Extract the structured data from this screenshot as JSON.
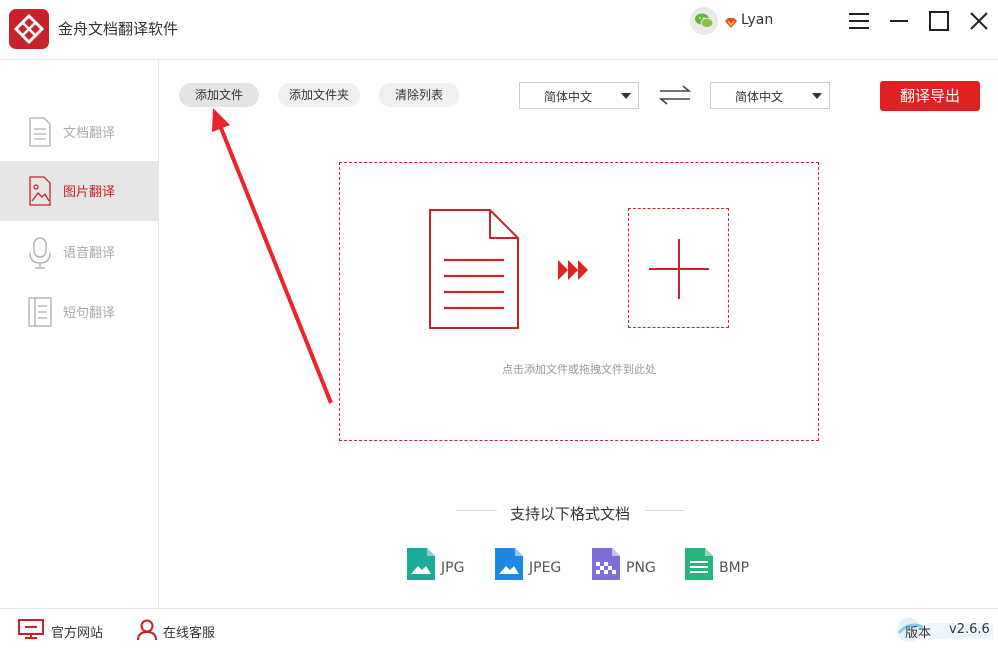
{
  "app": {
    "title": "金舟文档翻译软件",
    "accent": "#c8232c",
    "button_red": "#e02121"
  },
  "user": {
    "name": "Lyan"
  },
  "sidebar": {
    "items": [
      {
        "label": "文档翻译",
        "icon": "document-icon",
        "active": false
      },
      {
        "label": "图片翻译",
        "icon": "image-icon",
        "active": true
      },
      {
        "label": "语音翻译",
        "icon": "microphone-icon",
        "active": false
      },
      {
        "label": "短句翻译",
        "icon": "sentence-icon",
        "active": false
      }
    ]
  },
  "toolbar": {
    "add_file": "添加文件",
    "add_folder": "添加文件夹",
    "clear_list": "清除列表",
    "source_lang": "简体中文",
    "target_lang": "简体中文",
    "export": "翻译导出"
  },
  "dropzone": {
    "hint": "点击添加文件或拖拽文件到此处"
  },
  "formats": {
    "title": "支持以下格式文档",
    "items": [
      {
        "label": "JPG",
        "color": "#1aab9b"
      },
      {
        "label": "JPEG",
        "color": "#1e88e5"
      },
      {
        "label": "PNG",
        "color": "#7e6fd8"
      },
      {
        "label": "BMP",
        "color": "#26b57a"
      }
    ]
  },
  "footer": {
    "website": "官方网站",
    "support": "在线客服",
    "version_label": "版本",
    "version": "v2.6.6"
  }
}
